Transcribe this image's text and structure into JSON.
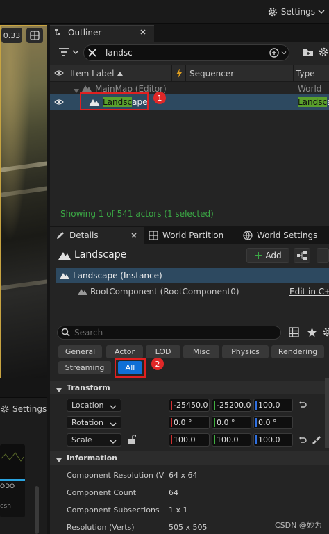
{
  "topbar": {
    "settings_label": "Settings"
  },
  "viewport": {
    "zoom": "0.33"
  },
  "left_panel": {
    "settings_label": "Settings",
    "thumb_label": "ODO",
    "thumb_sub": "esh"
  },
  "outliner": {
    "tab_label": "Outliner",
    "search_value": "landsc",
    "columns": {
      "item_label": "Item Label",
      "sequencer": "Sequencer",
      "type": "Type"
    },
    "rows": [
      {
        "label": "MainMap (Editor)",
        "type": "World"
      },
      {
        "label_match": "Landsc",
        "label_rest": "ape",
        "type_match": "Landsc",
        "type_rest": "ape"
      }
    ],
    "footer": "Showing 1 of 541 actors (1 selected)"
  },
  "details": {
    "tabs": {
      "details": "Details",
      "world_partition": "World Partition",
      "world_settings": "World Settings"
    },
    "actor_name": "Landscape",
    "add_label": "Add",
    "instance_label": "Landscape (Instance)",
    "root_component": "RootComponent (RootComponent0)",
    "edit_cpp": "Edit in C++",
    "search_placeholder": "Search",
    "filters": [
      "General",
      "Actor",
      "LOD",
      "Misc",
      "Physics",
      "Rendering",
      "Streaming",
      "All"
    ],
    "transform": {
      "header": "Transform",
      "location": {
        "label": "Location",
        "x": "-25450.0",
        "y": "-25200.0",
        "z": "100.0"
      },
      "rotation": {
        "label": "Rotation",
        "x": "0.0 °",
        "y": "0.0 °",
        "z": "0.0 °"
      },
      "scale": {
        "label": "Scale",
        "x": "100.0",
        "y": "100.0",
        "z": "100.0"
      }
    },
    "information": {
      "header": "Information",
      "rows": [
        {
          "label": "Component Resolution (Verts",
          "value": "64 x 64"
        },
        {
          "label": "Component Count",
          "value": "64"
        },
        {
          "label": "Component Subsections",
          "value": "1 x 1"
        },
        {
          "label": "Resolution (Verts)",
          "value": "505 x 505"
        }
      ]
    }
  },
  "annotations": {
    "badge1": "1",
    "badge2": "2"
  },
  "watermark": "CSDN @妙为",
  "colors": {
    "selection": "#2d4960",
    "match_highlight": "#5aa02c",
    "marker": "#e02020",
    "footer_text": "#3ba845"
  }
}
